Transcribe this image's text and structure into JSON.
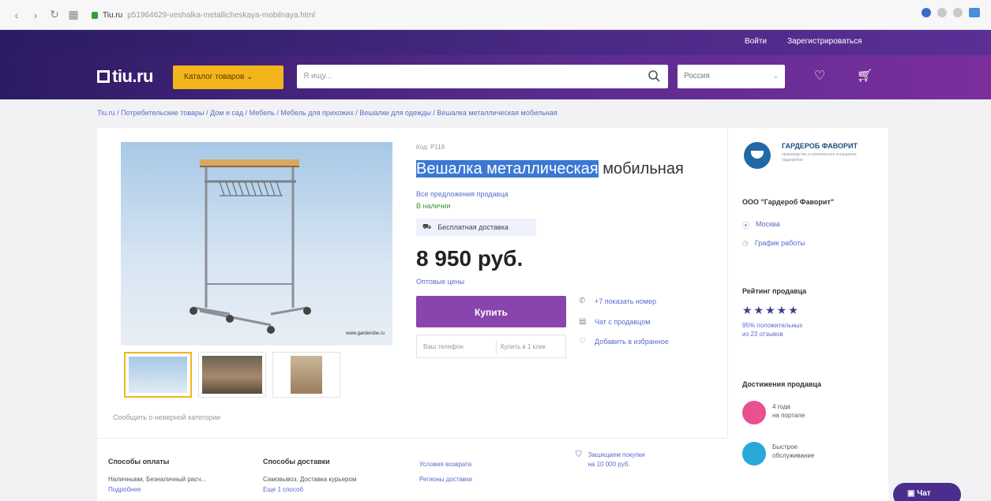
{
  "browser": {
    "url_host": "Tiu.ru",
    "url_path": "p51964629-veshalka-metallicheskaya-mobilnaya.html"
  },
  "topbar": {
    "login": "Войти",
    "register": "Зарегистрироваться"
  },
  "header": {
    "logo": "tiu.ru",
    "catalog": "Каталог товаров",
    "search_placeholder": "Я ищу...",
    "region": "Россия"
  },
  "breadcrumb": "Tiu.ru / Потребительские товары / Дом и сад / Мебель / Мебель для прихожих / Вешалки для одежды / Вешалка металлическая мобильная",
  "product": {
    "code": "Код: P118",
    "title_highlight": "Вешалка металлическая",
    "title_rest": " мобильная",
    "seller_offers": "Все предложения продавца",
    "availability": "В наличии",
    "delivery": "Бесплатная доставка",
    "price": "8 950 руб.",
    "wholesale": "Оптовые цены",
    "buy": "Купить",
    "phone_placeholder": "Ваш телефон",
    "one_click": "Купить в 1 клик",
    "report": "Сообщить о неверной категории",
    "watermark": "www.garderobe.ru"
  },
  "actions": [
    {
      "icon": "phone-icon",
      "label": "+7 показать номер"
    },
    {
      "icon": "chat-icon",
      "label": "Чат с продавцом"
    },
    {
      "icon": "heart-icon",
      "label": "Добавить в избранное"
    }
  ],
  "seller": {
    "brand": "ГАРДЕРОБ ФАВОРИТ",
    "tagline": "производство и комплексное оснащение гардеробов",
    "name": "ООО \"Гардероб Фаворит\"",
    "city": "Москва",
    "schedule": "График работы",
    "rating_title": "Рейтинг продавца",
    "rating_stars": "★★★★★",
    "rating_text_1": "95% положительных",
    "rating_text_2": "из 23 отзывов",
    "achievements_title": "Достижения продавца",
    "ach1_1": "4 года",
    "ach1_2": "на портале",
    "ach2_1": "Быстрое",
    "ach2_2": "обслуживание"
  },
  "bottom": {
    "payment_title": "Способы оплаты",
    "payment_text": "Наличными, Безналичный расч...",
    "payment_more": "Подробнее",
    "delivery_title": "Способы доставки",
    "delivery_text": "Самовывоз, Доставка курьером",
    "delivery_more": "Еще 1 способ",
    "return": "Условия возврата",
    "regions": "Регионы доставки",
    "guard_1": "Защищаем покупки",
    "guard_2": "на 10 000 руб."
  },
  "chat": "Чат",
  "colors": {
    "accent": "#8a44ad",
    "catalog": "#f2b51b",
    "header": "#4a2a86",
    "link": "#5a6ad0"
  }
}
